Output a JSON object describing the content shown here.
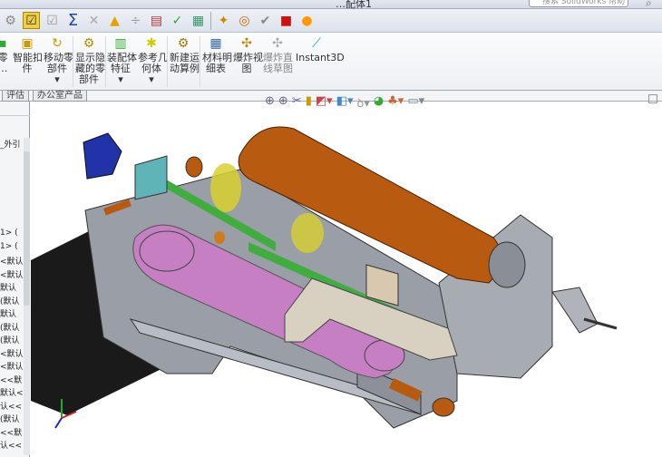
{
  "window": {
    "title": "…配体1",
    "search_placeholder": "搜索 SolidWorks 帮助"
  },
  "toolbar": {
    "icons": [
      "rebuild-icon",
      "options-icon",
      "check-icon",
      "sum-icon",
      "measure-icon",
      "warning-icon",
      "dimension-icon",
      "part-review-icon",
      "interference-icon",
      "table-icon",
      "display-icon",
      "hole-icon",
      "check-circle-icon",
      "color-icon",
      "appearance-icon"
    ]
  },
  "ribbon": {
    "items": [
      {
        "label": "零\n…"
      },
      {
        "label": "智能扣\n件"
      },
      {
        "label": "移动零\n部件"
      },
      {
        "label": "显示隐\n藏的零\n部件"
      },
      {
        "label": "装配体\n特征"
      },
      {
        "label": "参考几\n何体"
      },
      {
        "label": "新建运\n动算例"
      },
      {
        "label": "材料明\n细表"
      },
      {
        "label": "爆炸视\n图"
      },
      {
        "label": "爆炸直\n线草图"
      },
      {
        "label": "Instant3D"
      }
    ]
  },
  "tabs": [
    "评估",
    "办公室产品"
  ],
  "tree": {
    "items": [
      "_外引",
      "1> (",
      "1> (",
      "<默认",
      "<默认",
      "默认",
      "(默认",
      "默认",
      "(默认",
      "(默认",
      "<默认",
      "<默认",
      "<<默",
      "默认<",
      "认<<",
      "(默认",
      "<<默",
      "认<<"
    ]
  },
  "colors": {
    "motor": "#b85a10",
    "frame": "#9a9ea6",
    "belt": "#c77fc4",
    "bracket": "#d8d0c0",
    "green": "#3fae3f",
    "yellow": "#d8d030",
    "blue": "#2233aa",
    "black": "#1a1a1a"
  }
}
